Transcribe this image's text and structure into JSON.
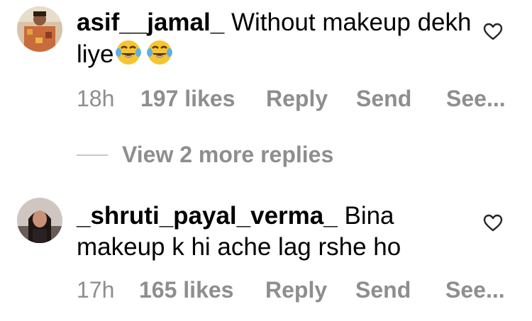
{
  "comments": [
    {
      "username": "asif__jamal_",
      "text": "Without makeup dekh liye",
      "emojis": [
        "😂",
        "😂"
      ],
      "time": "18h",
      "likes": "197 likes",
      "reply_label": "Reply",
      "send_label": "Send",
      "see_label": "See..."
    },
    {
      "username": "_shruti_payal_verma_",
      "text": "Bina makeup k hi ache lag rshe ho",
      "time": "17h",
      "likes": "165 likes",
      "reply_label": "Reply",
      "send_label": "Send",
      "see_label": "See..."
    }
  ],
  "replies_toggle": {
    "label": "View 2 more replies"
  },
  "icons": {
    "like": "heart-outline-icon",
    "emoji": "face-with-tears-of-joy-emoji"
  },
  "colors": {
    "text": "#000000",
    "muted": "#8e8e8e",
    "divider": "#c7c7c7",
    "background": "#ffffff"
  }
}
